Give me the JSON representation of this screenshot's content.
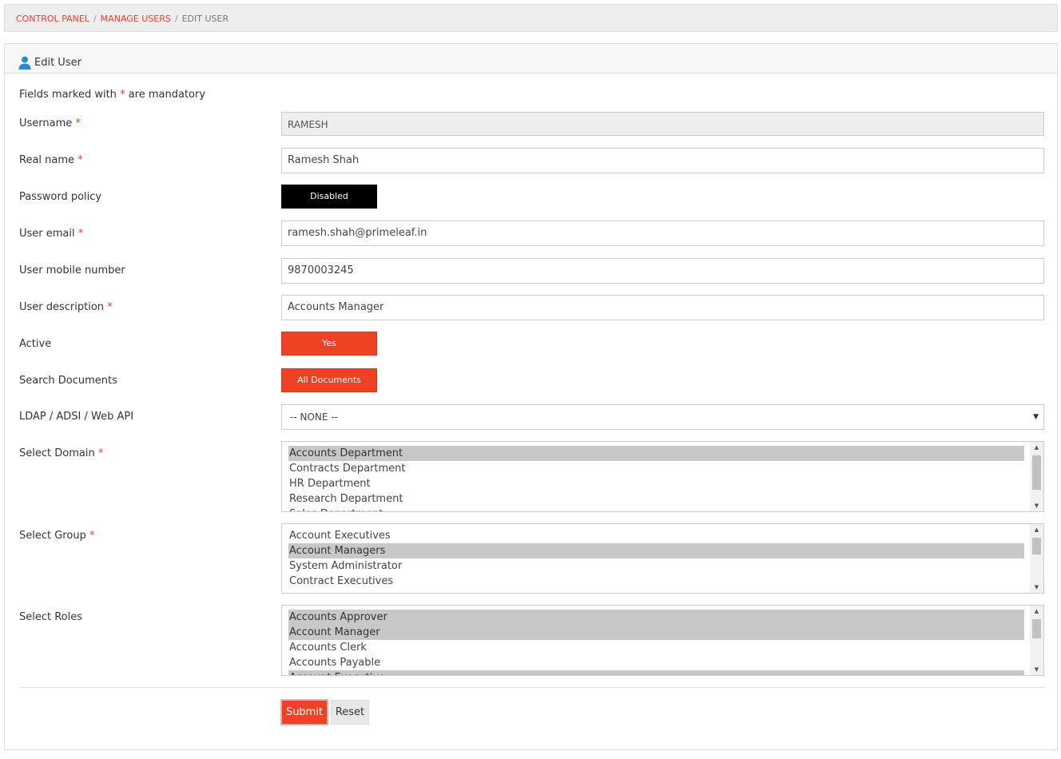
{
  "breadcrumb": {
    "control_panel": "CONTROL PANEL",
    "manage_users": "MANAGE USERS",
    "edit_user": "EDIT USER",
    "separator": "/"
  },
  "panel": {
    "title": "Edit User",
    "icon": "user-icon"
  },
  "form": {
    "mandatory_prefix": "Fields marked with",
    "mandatory_star": "*",
    "mandatory_suffix": "are mandatory",
    "username": {
      "label": "Username",
      "value": "RAMESH"
    },
    "real_name": {
      "label": "Real name",
      "value": "Ramesh Shah"
    },
    "password_policy": {
      "label": "Password policy",
      "value": "Disabled"
    },
    "email": {
      "label": "User email",
      "value": "ramesh.shah@primeleaf.in"
    },
    "mobile": {
      "label": "User mobile number",
      "value": "9870003245"
    },
    "description": {
      "label": "User description",
      "value": "Accounts Manager"
    },
    "active": {
      "label": "Active",
      "value": "Yes"
    },
    "search_documents": {
      "label": "Search Documents",
      "value": "All Documents"
    },
    "ldap": {
      "label": "LDAP / ADSI / Web API",
      "value": "-- NONE --"
    },
    "domain": {
      "label": "Select Domain",
      "options": [
        "Accounts Department",
        "Contracts Department",
        "HR Department",
        "Research Department",
        "Sales Department"
      ],
      "selected": [
        0
      ]
    },
    "group": {
      "label": "Select Group",
      "options": [
        "Account Executives",
        "Account Managers",
        "System Administrator",
        "Contract Executives"
      ],
      "selected": [
        1
      ]
    },
    "roles": {
      "label": "Select Roles",
      "options": [
        "Accounts Approver",
        "Account Manager",
        "Accounts Clerk",
        "Accounts Payable",
        "Account Executive"
      ],
      "selected": [
        0,
        1,
        4
      ]
    },
    "submit_label": "Submit",
    "reset_label": "Reset"
  },
  "colors": {
    "accent": "#f04124",
    "toggle_off": "#000000",
    "selected_option": "#c8c8c8"
  }
}
